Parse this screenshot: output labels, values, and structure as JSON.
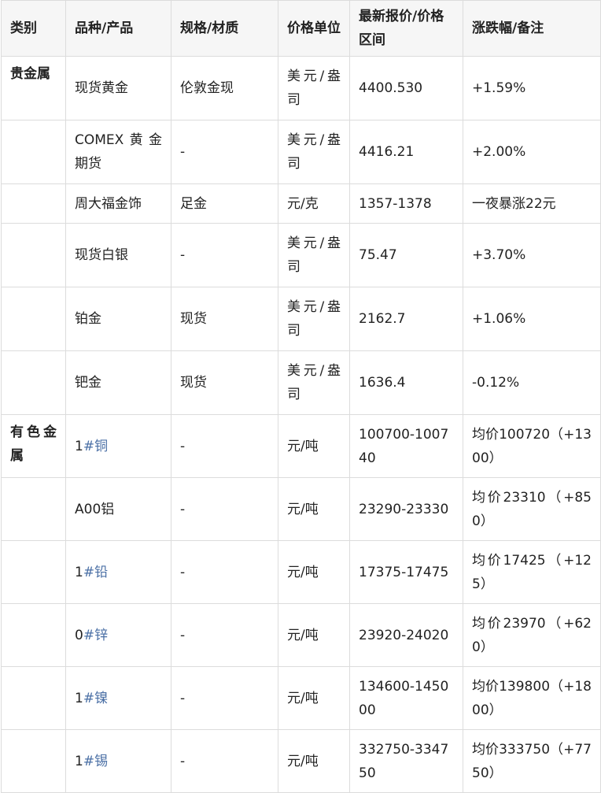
{
  "headers": [
    "类别",
    "品种/产品",
    "规格/材质",
    "价格单位",
    "最新报价/价格区间",
    "涨跌幅/备注"
  ],
  "rows": [
    {
      "category": "贵金属",
      "prefix": "",
      "product_link": "",
      "product": "现货黄金",
      "spec": "伦敦金现",
      "unit": "美元/盎司",
      "price": "4400.530",
      "change": "+1.59%"
    },
    {
      "category": "",
      "prefix": "",
      "product_link": "",
      "product": "COMEX黄金期货",
      "spec": "-",
      "unit": "美元/盎司",
      "price": "4416.21",
      "change": "+2.00%"
    },
    {
      "category": "",
      "prefix": "",
      "product_link": "",
      "product": "周大福金饰",
      "spec": "足金",
      "unit": "元/克",
      "price": "1357-1378",
      "change": "一夜暴涨22元"
    },
    {
      "category": "",
      "prefix": "",
      "product_link": "",
      "product": "现货白银",
      "spec": "-",
      "unit": "美元/盎司",
      "price": "75.47",
      "change": "+3.70%"
    },
    {
      "category": "",
      "prefix": "",
      "product_link": "",
      "product": "铂金",
      "spec": "现货",
      "unit": "美元/盎司",
      "price": "2162.7",
      "change": "+1.06%"
    },
    {
      "category": "",
      "prefix": "",
      "product_link": "",
      "product": "钯金",
      "spec": "现货",
      "unit": "美元/盎司",
      "price": "1636.4",
      "change": "-0.12%"
    },
    {
      "category": "有色金属",
      "prefix": "1",
      "product_link": "#铜",
      "product": "",
      "spec": "-",
      "unit": "元/吨",
      "price": "100700-100740",
      "change": "均价100720（+1300）"
    },
    {
      "category": "",
      "prefix": "",
      "product_link": "",
      "product": "A00铝",
      "spec": "-",
      "unit": "元/吨",
      "price": "23290-23330",
      "change": "均价23310（+850）"
    },
    {
      "category": "",
      "prefix": "1",
      "product_link": "#铅",
      "product": "",
      "spec": "-",
      "unit": "元/吨",
      "price": "17375-17475",
      "change": "均价17425（+125）"
    },
    {
      "category": "",
      "prefix": "0",
      "product_link": "#锌",
      "product": "",
      "spec": "-",
      "unit": "元/吨",
      "price": "23920-24020",
      "change": "均价23970（+620）"
    },
    {
      "category": "",
      "prefix": "1",
      "product_link": "#镍",
      "product": "",
      "spec": "-",
      "unit": "元/吨",
      "price": "134600-145000",
      "change": "均价139800（+1800）"
    },
    {
      "category": "",
      "prefix": "1",
      "product_link": "#锡",
      "product": "",
      "spec": "-",
      "unit": "元/吨",
      "price": "332750-334750",
      "change": "均价333750（+7750）"
    }
  ],
  "colors": {
    "border": "#dcdcdc",
    "header_bg": "#f6f6f6",
    "link": "#4a6fa5",
    "text": "#222222"
  }
}
